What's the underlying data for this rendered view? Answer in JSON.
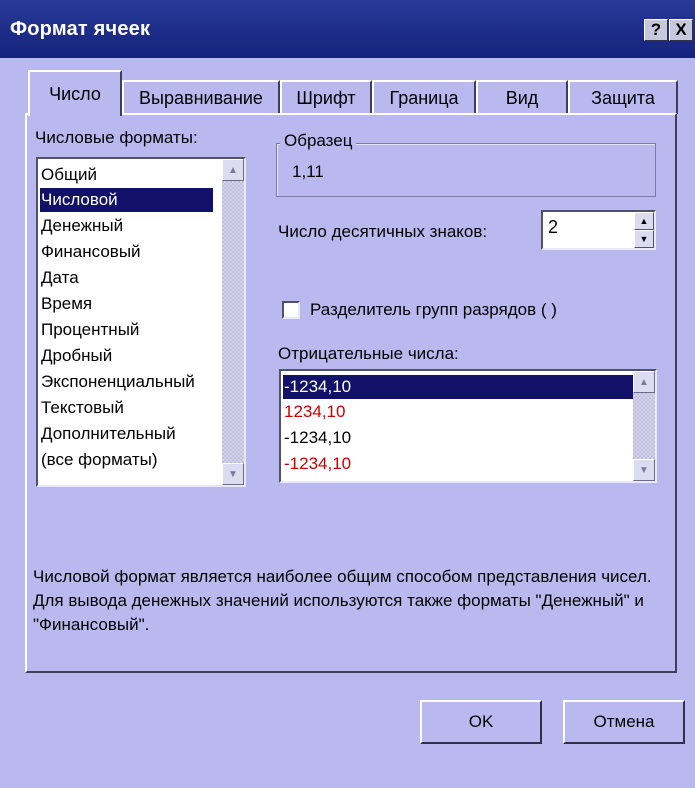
{
  "window": {
    "title": "Формат ячеек",
    "help_glyph": "?",
    "close_glyph": "X"
  },
  "tabs": [
    {
      "label": "Число",
      "active": true
    },
    {
      "label": "Выравнивание"
    },
    {
      "label": "Шрифт"
    },
    {
      "label": "Граница"
    },
    {
      "label": "Вид"
    },
    {
      "label": "Защита"
    }
  ],
  "formats": {
    "label": "Числовые форматы:",
    "items": [
      "Общий",
      "Числовой",
      "Денежный",
      "Финансовый",
      "Дата",
      "Время",
      "Процентный",
      "Дробный",
      "Экспоненциальный",
      "Текстовый",
      "Дополнительный",
      "(все форматы)"
    ],
    "selected_index": 1
  },
  "sample": {
    "label": "Образец",
    "value": "1,11"
  },
  "decimals": {
    "label": "Число десятичных знаков:",
    "value": "2"
  },
  "separator": {
    "label": "Разделитель групп разрядов ( )",
    "checked": false
  },
  "negatives": {
    "label": "Отрицательные числа:",
    "items": [
      {
        "text": "-1234,10",
        "color": "#000000"
      },
      {
        "text": "1234,10",
        "color": "#cc0000"
      },
      {
        "text": "-1234,10",
        "color": "#000000"
      },
      {
        "text": "-1234,10",
        "color": "#cc0000"
      }
    ],
    "selected_index": 0
  },
  "description": "Числовой формат является наиболее общим способом представления чисел. Для вывода денежных значений используются также форматы \"Денежный\" и \"Финансовый\".",
  "buttons": {
    "ok": "OK",
    "cancel": "Отмена"
  },
  "icons": {
    "scroll_up": "triangle-up",
    "scroll_down": "triangle-down",
    "spin_up": "triangle-up",
    "spin_down": "triangle-down"
  }
}
